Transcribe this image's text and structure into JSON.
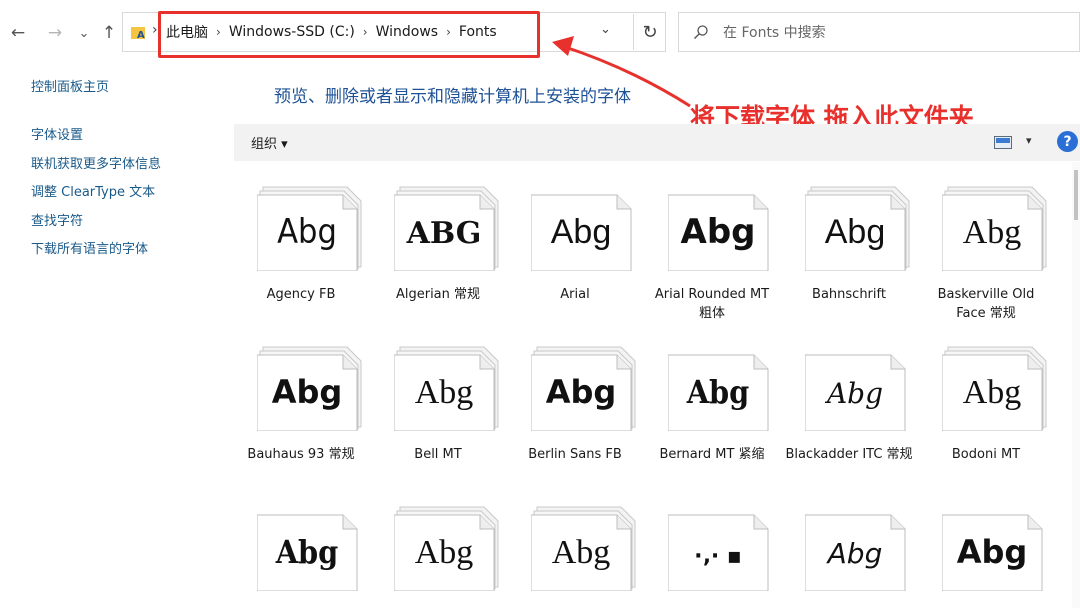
{
  "nav": {
    "back": "←",
    "forward": "→",
    "recent": "⌄",
    "up": "↑"
  },
  "address": {
    "crumbs": [
      "此电脑",
      "Windows-SSD (C:)",
      "Windows",
      "Fonts"
    ],
    "chevron": "›",
    "dropdown": "⌄",
    "refresh": "↻"
  },
  "search": {
    "placeholder": "在 Fonts 中搜索"
  },
  "left_pane": {
    "home": "控制面板主页",
    "items": [
      "字体设置",
      "联机获取更多字体信息",
      "调整 ClearType 文本",
      "查找字符",
      "下载所有语言的字体"
    ]
  },
  "headline": "预览、删除或者显示和隐藏计算机上安装的字体",
  "annotation": {
    "text": "将下载字体 拖入此文件夹",
    "color": "#e8312d"
  },
  "toolbar": {
    "organize": "组织 ▾",
    "view_dd": "▾",
    "help": "?"
  },
  "colors": {
    "link": "#1a5a8a",
    "headline": "#1e5296",
    "accent": "#2a6fd6"
  },
  "fonts": [
    {
      "name": "Agency FB",
      "sample": "Abg"
    },
    {
      "name": "Algerian 常规",
      "sample": "ABG"
    },
    {
      "name": "Arial",
      "sample": "Abg"
    },
    {
      "name": "Arial Rounded MT 粗体",
      "sample": "Abg"
    },
    {
      "name": "Bahnschrift",
      "sample": "Abg"
    },
    {
      "name": "Baskerville Old Face 常规",
      "sample": "Abg"
    },
    {
      "name": "Bauhaus 93 常规",
      "sample": "Abg"
    },
    {
      "name": "Bell MT",
      "sample": "Abg"
    },
    {
      "name": "Berlin Sans FB",
      "sample": "Abg"
    },
    {
      "name": "Bernard MT 紧缩",
      "sample": "Abg"
    },
    {
      "name": "Blackadder ITC 常规",
      "sample": "Abg"
    },
    {
      "name": "Bodoni MT",
      "sample": "Abg"
    },
    {
      "name": "",
      "sample": "Abg"
    },
    {
      "name": "",
      "sample": "Abg"
    },
    {
      "name": "",
      "sample": "Abg"
    },
    {
      "name": "",
      "sample": "·‚· ▪"
    },
    {
      "name": "",
      "sample": "Abg"
    },
    {
      "name": "",
      "sample": "Abg"
    }
  ]
}
